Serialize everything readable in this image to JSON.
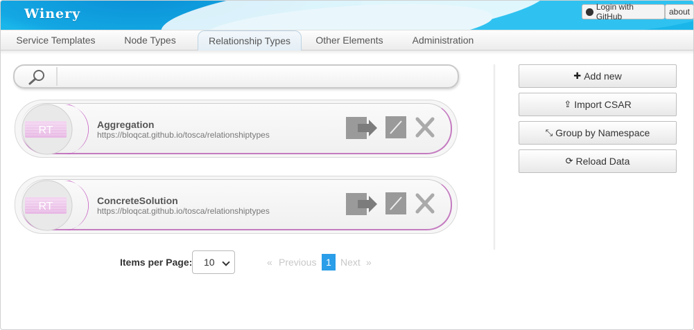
{
  "app": {
    "title": "Winery",
    "login_label": "Login with GitHub",
    "about_label": "about"
  },
  "nav": {
    "tabs": [
      {
        "label": "Service Templates",
        "active": false
      },
      {
        "label": "Node Types",
        "active": false
      },
      {
        "label": "Relationship Types",
        "active": true
      },
      {
        "label": "Other Elements",
        "active": false
      },
      {
        "label": "Administration",
        "active": false
      }
    ]
  },
  "search": {
    "value": "",
    "placeholder": ""
  },
  "items": [
    {
      "badge": "RT",
      "name": "Aggregation",
      "namespace": "https://bloqcat.github.io/tosca/relationshiptypes"
    },
    {
      "badge": "RT",
      "name": "ConcreteSolution",
      "namespace": "https://bloqcat.github.io/tosca/relationshiptypes"
    }
  ],
  "actions": {
    "add_new": "Add new",
    "import_csar": "Import CSAR",
    "group_by_namespace": "Group by Namespace",
    "reload_data": "Reload Data"
  },
  "pagination": {
    "items_per_page_label": "Items per Page:",
    "items_per_page_value": "10",
    "prev_arrow": "«",
    "previous_label": "Previous",
    "current_page": "1",
    "next_label": "Next",
    "next_arrow": "»"
  },
  "colors": {
    "header_blue": "#1ab6ea",
    "accent_magenta": "#c65bc3",
    "page_active": "#2a9ee8"
  }
}
